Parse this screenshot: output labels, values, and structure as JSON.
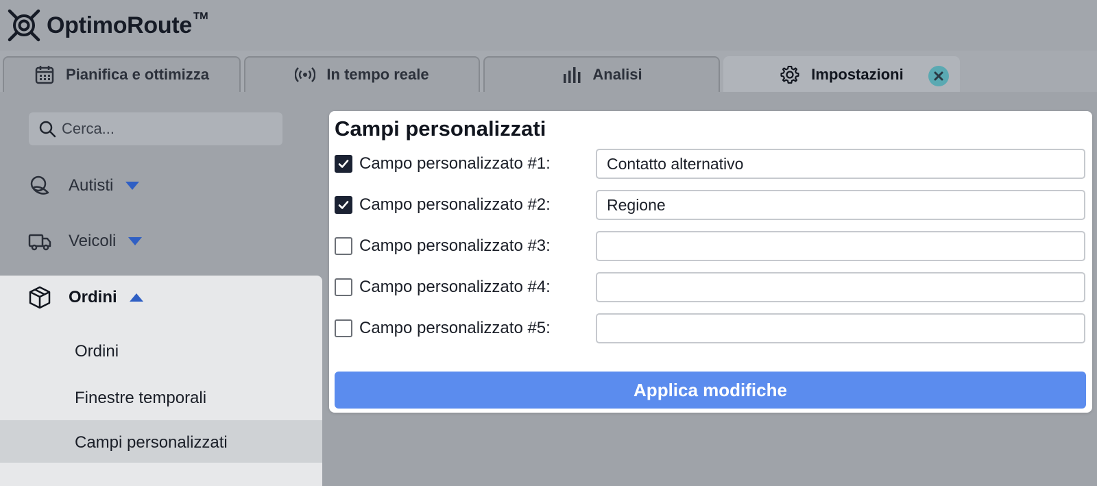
{
  "app": {
    "name": "OptimoRoute",
    "trademark": "TM"
  },
  "tabs": [
    {
      "label": "Pianifica e ottimizza",
      "icon": "calendar-icon"
    },
    {
      "label": "In tempo reale",
      "icon": "broadcast-icon"
    },
    {
      "label": "Analisi",
      "icon": "bar-chart-icon"
    },
    {
      "label": "Impostazioni",
      "icon": "gear-icon",
      "active": true
    }
  ],
  "sidebar": {
    "search_placeholder": "Cerca...",
    "items": [
      {
        "label": "Autisti",
        "icon": "driver-icon",
        "expanded": false
      },
      {
        "label": "Veicoli",
        "icon": "truck-icon",
        "expanded": false
      },
      {
        "label": "Ordini",
        "icon": "package-icon",
        "expanded": true,
        "children": [
          {
            "label": "Ordini"
          },
          {
            "label": "Finestre temporali"
          },
          {
            "label": "Campi personalizzati",
            "selected": true
          }
        ]
      }
    ]
  },
  "dialog": {
    "title": "Campi personalizzati",
    "fields": [
      {
        "label": "Campo personalizzato #1:",
        "checked": true,
        "value": "Contatto alternativo"
      },
      {
        "label": "Campo personalizzato #2:",
        "checked": true,
        "value": "Regione"
      },
      {
        "label": "Campo personalizzato #3:",
        "checked": false,
        "value": ""
      },
      {
        "label": "Campo personalizzato #4:",
        "checked": false,
        "value": ""
      },
      {
        "label": "Campo personalizzato #5:",
        "checked": false,
        "value": ""
      }
    ],
    "apply_label": "Applica modifiche"
  },
  "colors": {
    "accent": "#5b8cee",
    "caret": "#2f5fc4",
    "close": "#5aa9b2"
  }
}
